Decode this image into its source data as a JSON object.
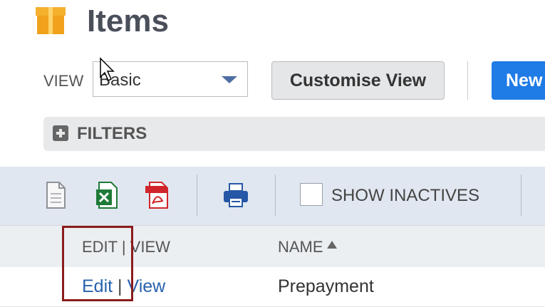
{
  "header": {
    "title": "Items",
    "icon": "box-icon"
  },
  "view": {
    "label": "VIEW",
    "selected": "Basic"
  },
  "buttons": {
    "customise": "Customise View",
    "new": "New"
  },
  "filters": {
    "label": "FILTERS"
  },
  "toolbar": {
    "icons": [
      "document-icon",
      "excel-icon",
      "pdf-icon",
      "print-icon"
    ],
    "show_inactives_label": "SHOW INACTIVES"
  },
  "table": {
    "columns": {
      "edit_view": "EDIT | VIEW",
      "name": "NAME"
    },
    "rows": [
      {
        "edit": "Edit",
        "sep": " | ",
        "view": "View",
        "name": "Prepayment"
      }
    ]
  },
  "colors": {
    "accent": "#1f7be6",
    "toolbar_bg": "#e0e7f0",
    "highlight": "#8b1d1d"
  }
}
